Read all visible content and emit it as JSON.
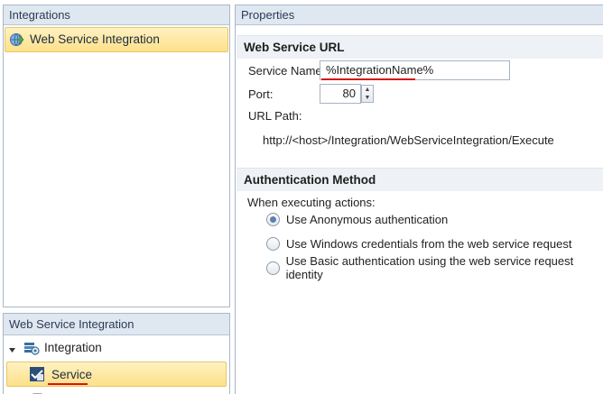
{
  "integrations_panel": {
    "title": "Integrations",
    "items": [
      {
        "label": "Web Service Integration",
        "icon": "web-service-icon",
        "selected": true
      }
    ]
  },
  "tree_panel": {
    "title": "Web Service Integration",
    "root": {
      "label": "Integration",
      "icon": "integration-icon",
      "expanded": true
    },
    "child": {
      "label": "Service",
      "icon": "service-icon",
      "selected": true
    }
  },
  "properties": {
    "title": "Properties",
    "url_section": {
      "title": "Web Service URL",
      "service_name_label": "Service Name:",
      "service_name_value": "%IntegrationName%",
      "port_label": "Port:",
      "port_value": "80",
      "url_path_label": "URL Path:",
      "url_path_value": "http://<host>/Integration/WebServiceIntegration/Execute"
    },
    "auth_section": {
      "title": "Authentication Method",
      "intro": "When executing actions:",
      "options": [
        {
          "label": "Use Anonymous authentication",
          "checked": true
        },
        {
          "label": "Use Windows credentials from the web service request",
          "checked": false
        },
        {
          "label": "Use Basic authentication using the web service request identity",
          "checked": false
        }
      ]
    }
  },
  "colors": {
    "selection": "#fde089",
    "header": "#dfe7f1",
    "annotation": "#d51515"
  }
}
